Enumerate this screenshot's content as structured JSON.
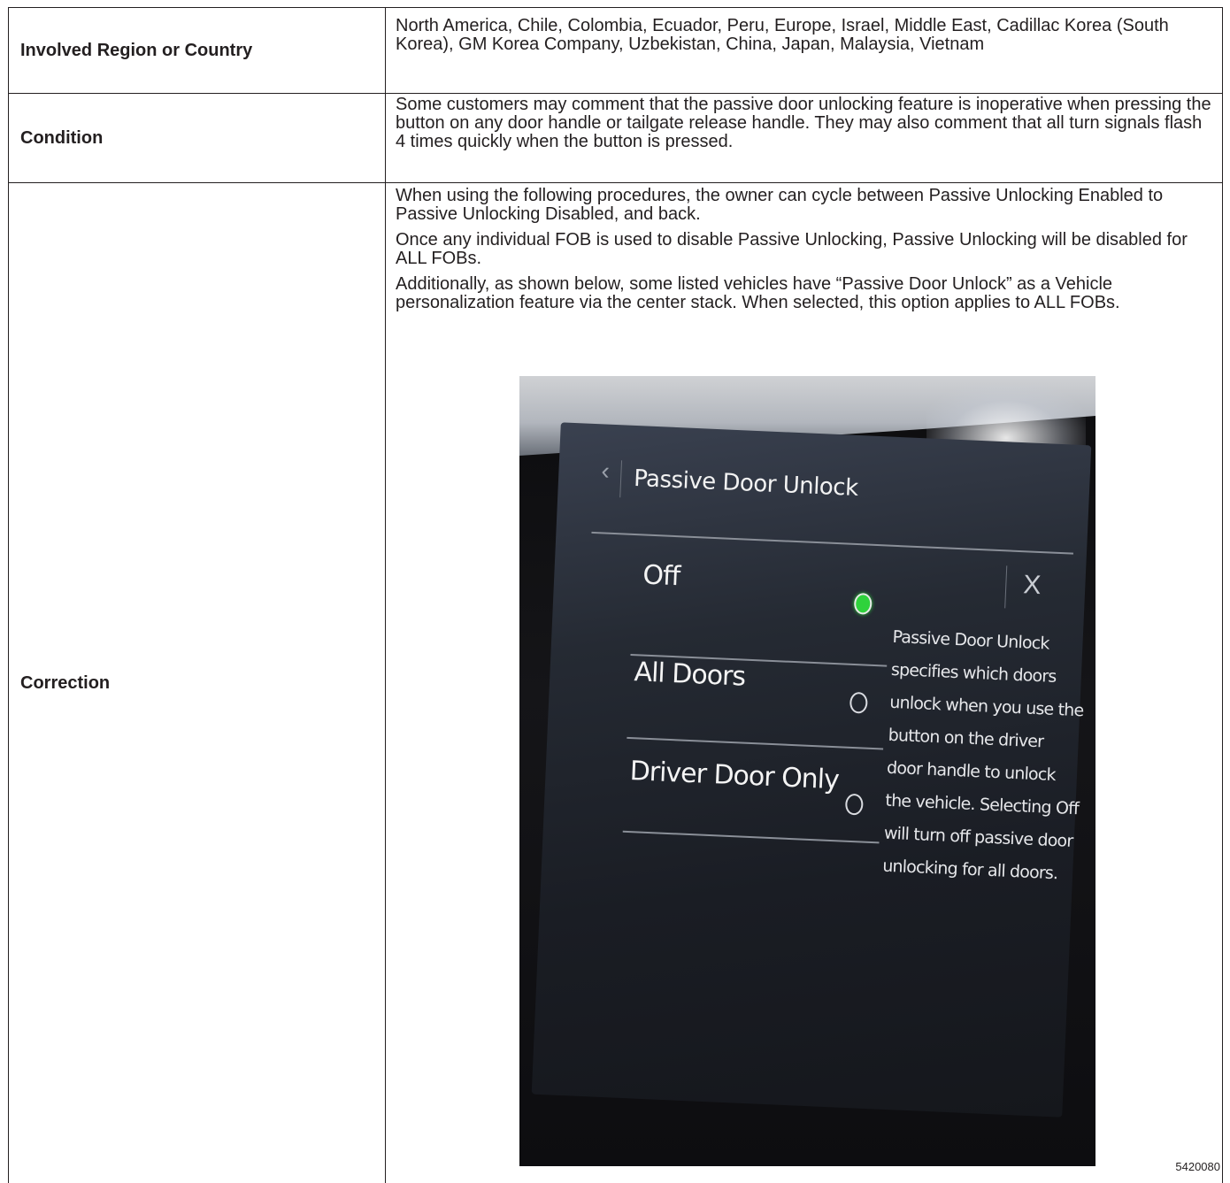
{
  "table": {
    "rows": [
      {
        "label": "Involved Region or Country",
        "text": "North America, Chile, Colombia, Ecuador, Peru, Europe, Israel, Middle East, Cadillac Korea (South Korea), GM Korea Company, Uzbekistan, China, Japan, Malaysia, Vietnam"
      },
      {
        "label": "Condition",
        "text": "Some customers may comment that the passive door unlocking feature is inoperative when pressing the button on any door handle or tailgate release handle. They may also comment that all turn signals flash 4 times quickly when the button is pressed."
      },
      {
        "label": "Correction",
        "paragraphs": [
          "When using the following procedures, the owner can cycle between Passive Unlocking Enabled to Passive Unlocking Disabled, and back.",
          "Once any individual FOB is used to disable Passive Unlocking, Passive Unlocking will be disabled for ALL FOBs.",
          "Additionally, as shown below, some listed vehicles have “Passive Door Unlock” as a Vehicle personalization feature via the center stack. When selected, this option applies to ALL FOBs."
        ]
      }
    ]
  },
  "figure": {
    "screen_title": "Passive Door Unlock",
    "back_glyph": "‹",
    "close_glyph": "X",
    "options": [
      {
        "label": "Off",
        "selected": true
      },
      {
        "label": "All Doors",
        "selected": false
      },
      {
        "label": "Driver Door Only",
        "selected": false
      }
    ],
    "help_text": "Passive Door Unlock specifies which doors unlock when you use the button on the driver door handle to unlock the vehicle. Selecting Off will turn off passive door unlocking for all doors.",
    "figure_number": "5420080",
    "colors": {
      "selected_radio": "#2fd23c",
      "screen_bg": "#252a33"
    }
  }
}
